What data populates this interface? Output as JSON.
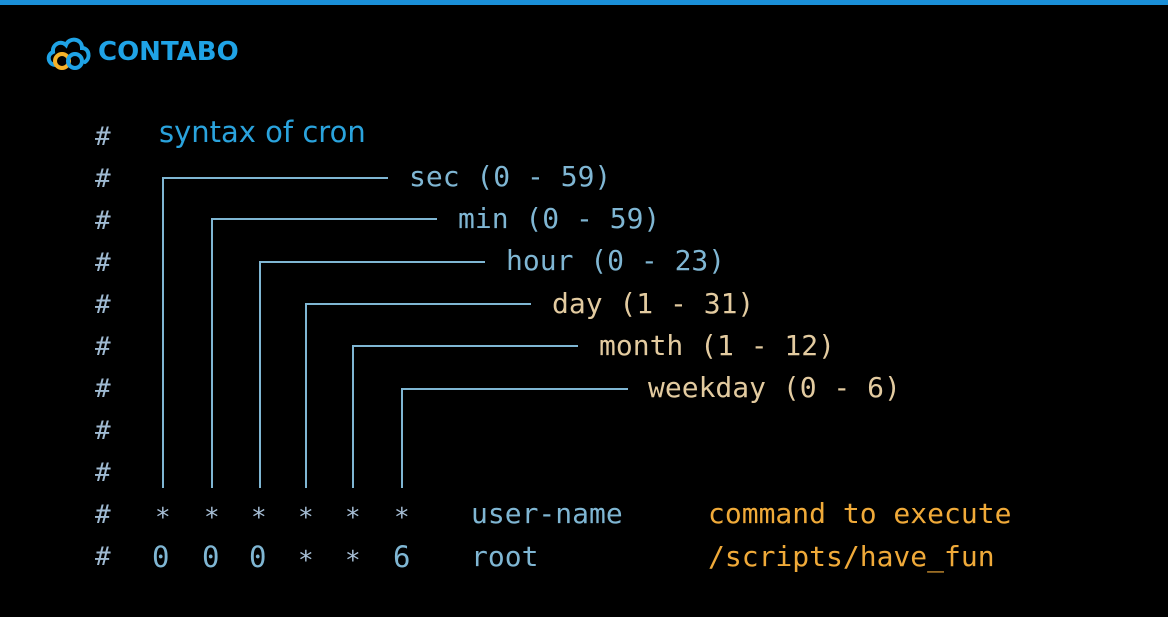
{
  "brand": {
    "name": "CONTABO",
    "icon": "cloud-icon",
    "accent": "#1a8fd8"
  },
  "title": "syntax of cron",
  "comment_char": "#",
  "fields": [
    {
      "label": "sec (0 - 59)"
    },
    {
      "label": "min (0 - 59)"
    },
    {
      "label": "hour (0 - 23)"
    },
    {
      "label": "day (1 - 31)"
    },
    {
      "label": "month (1 - 12)"
    },
    {
      "label": "weekday (0 - 6)"
    }
  ],
  "header_row": {
    "symbols": [
      "*",
      "*",
      "*",
      "*",
      "*",
      "*"
    ],
    "user": "user-name",
    "command": "command to execute"
  },
  "example_row": {
    "values": [
      "0",
      "0",
      "0",
      "*",
      "*",
      "6"
    ],
    "user": "root",
    "command": "/scripts/have_fun"
  }
}
